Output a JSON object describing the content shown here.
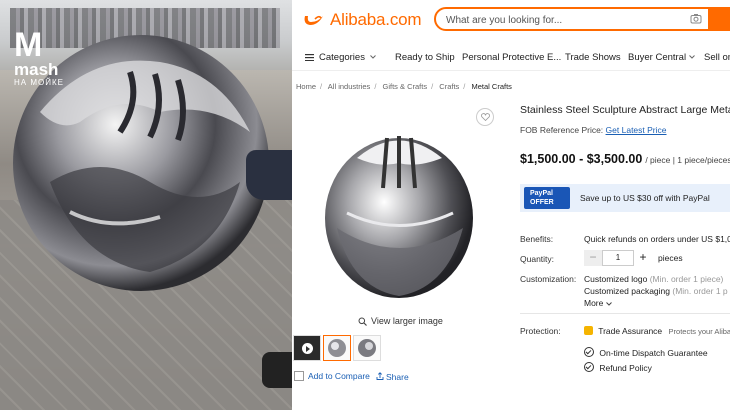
{
  "photo": {
    "watermark": {
      "brand": "mash",
      "sub": "НА МОЙКЕ"
    }
  },
  "header": {
    "logo": "Alibaba.com",
    "search": {
      "placeholder": "What are you looking for..."
    }
  },
  "nav": {
    "categories": "Categories",
    "items": [
      "Ready to Ship",
      "Personal Protective E...",
      "Trade Shows",
      "Buyer Central",
      "Sell on"
    ]
  },
  "breadcrumb": [
    "Home",
    "All industries",
    "Gifts & Crafts",
    "Crafts",
    "Metal Crafts"
  ],
  "gallery": {
    "view_larger": "View larger image",
    "add_to_compare": "Add to Compare",
    "share": "Share"
  },
  "product": {
    "title": "Stainless Steel Sculpture Abstract Large Metal S",
    "fob_label": "FOB Reference",
    "price_label": "Price:",
    "price_link": "Get Latest Price",
    "price_range": "$1,500.00 - $3,500.00",
    "price_unit": "/ piece | 1 piece/pieces",
    "paypal": {
      "badge_line1": "PayPal",
      "badge_line2": "OFFER",
      "text": "Save up to US $30 off with PayPal"
    },
    "benefits_label": "Benefits:",
    "benefits_value": "Quick refunds on orders under US $1,0",
    "quantity_label": "Quantity:",
    "quantity_value": "1",
    "quantity_unit": "pieces",
    "customization_label": "Customization:",
    "custom_logo": "Customized logo",
    "custom_logo_min": "(Min. order 1 piece)",
    "custom_packaging": "Customized packaging",
    "custom_packaging_min": "(Min. order 1 p",
    "more": "More",
    "protection_label": "Protection:",
    "trade_assurance": "Trade Assurance",
    "trade_assurance_note": "Protects your Aliba",
    "ontime": "On-time Dispatch Guarantee",
    "refund": "Refund Policy"
  },
  "colors": {
    "brand": "#ff6a00",
    "link": "#1a5fb4",
    "paypal": "#1a56b6"
  }
}
